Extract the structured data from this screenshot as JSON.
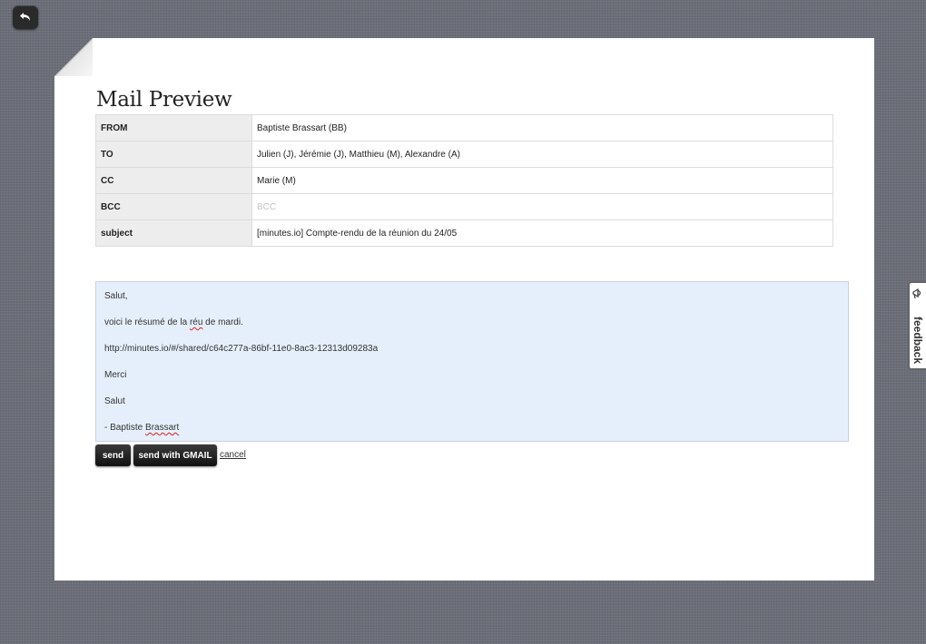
{
  "mail_preview": {
    "title": "Mail Preview",
    "fields": {
      "from": {
        "label": "FROM",
        "value": "Baptiste Brassart (BB)"
      },
      "to": {
        "label": "TO",
        "value": "Julien (J), Jérémie (J), Matthieu (M), Alexandre (A)"
      },
      "cc": {
        "label": "CC",
        "value": "Marie (M)"
      },
      "bcc": {
        "label": "BCC",
        "placeholder": "BCC"
      },
      "subject": {
        "label": "subject",
        "value": "[minutes.io] Compte-rendu de la réunion du 24/05"
      }
    },
    "body": {
      "greeting": "Salut,",
      "line1_before": "voici le résumé de la ",
      "line1_misspelled": "réu",
      "line1_after": " de mardi.",
      "link": "http://minutes.io/#/shared/c64c277a-86bf-11e0-8ac3-12313d09283a",
      "thanks": "Merci",
      "closing": "Salut",
      "signature_prefix": "- Baptiste ",
      "signature_misspelled": "Brassart"
    },
    "actions": {
      "send": "send",
      "send_gmail": "send with GMAIL",
      "cancel": "cancel"
    }
  },
  "feedback_tab": {
    "label": "feedback",
    "icon": "megaphone-icon"
  },
  "toolbar": {
    "back_icon": "undo-arrow-icon"
  }
}
